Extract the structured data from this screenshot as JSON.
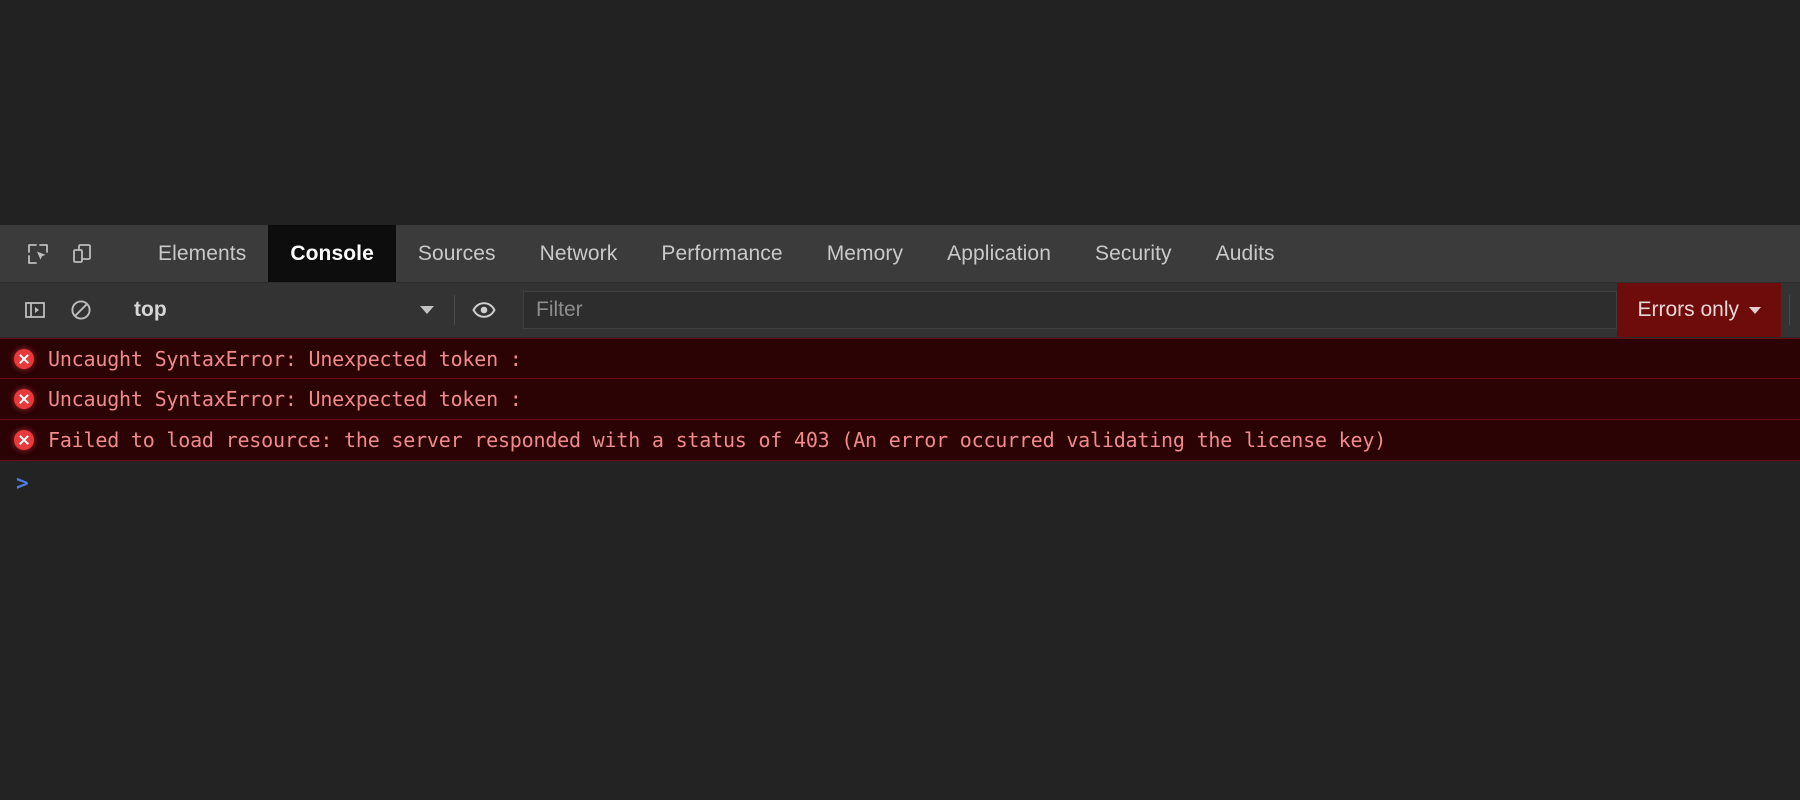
{
  "window": {
    "page_background_color": "#222222",
    "devtools_background_color": "#242424"
  },
  "tabbar": {
    "icons": [
      {
        "name": "inspect-element-icon",
        "title": "Inspect element"
      },
      {
        "name": "device-toolbar-icon",
        "title": "Toggle device toolbar"
      }
    ],
    "tabs": [
      {
        "label": "Elements",
        "active": false
      },
      {
        "label": "Console",
        "active": true
      },
      {
        "label": "Sources",
        "active": false
      },
      {
        "label": "Network",
        "active": false
      },
      {
        "label": "Performance",
        "active": false
      },
      {
        "label": "Memory",
        "active": false
      },
      {
        "label": "Application",
        "active": false
      },
      {
        "label": "Security",
        "active": false
      },
      {
        "label": "Audits",
        "active": false
      }
    ],
    "active_tab": "Console",
    "active_tab_background": "#0d0d0d"
  },
  "toolbar": {
    "sidebar_toggle_icon": "show-console-sidebar-icon",
    "clear_console_icon": "clear-console-icon",
    "context_selector": {
      "value": "top",
      "caret": "▾"
    },
    "eye_icon": "live-expression-eye-icon",
    "filter": {
      "value": "",
      "placeholder": "Filter"
    },
    "level_selector": {
      "label": "Errors only",
      "caret": "▾",
      "background_color": "#6e0b0b",
      "text_color": "#e9d6d6"
    }
  },
  "console": {
    "background_color": "#232323",
    "error_row_background": "#2b0305",
    "error_row_border": "#6b0d10",
    "error_text_color": "#f08a8c",
    "messages": [
      {
        "icon": "error-circle-icon",
        "level": "error",
        "text": "Uncaught SyntaxError: Unexpected token :"
      },
      {
        "icon": "error-circle-icon",
        "level": "error",
        "text": "Uncaught SyntaxError: Unexpected token :"
      },
      {
        "icon": "error-circle-icon",
        "level": "error",
        "text": "Failed to load resource: the server responded with a status of 403 (An error occurred validating the license key)"
      }
    ],
    "prompt": {
      "chevron": ">",
      "value": "",
      "placeholder": ""
    }
  }
}
